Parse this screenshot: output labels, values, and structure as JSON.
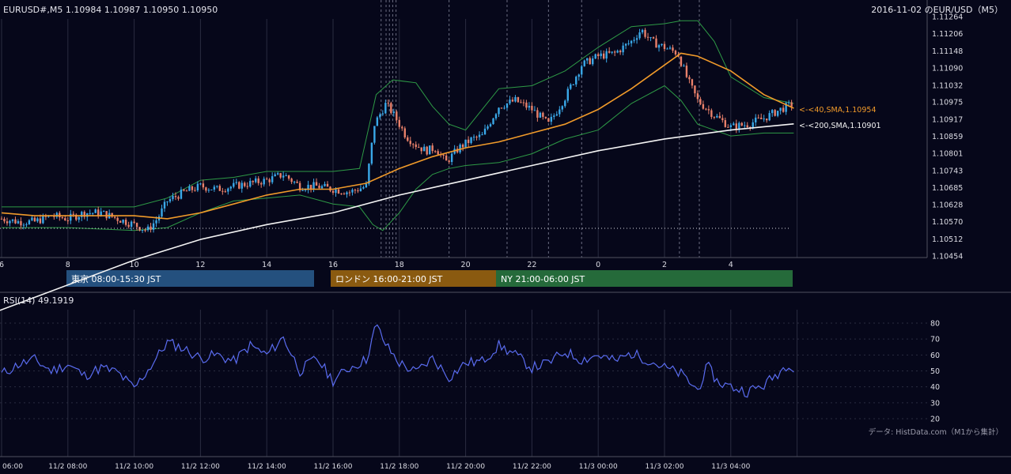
{
  "header": {
    "symbol_info": "EURUSD#,M5 1.10984 1.10987 1.10950 1.10950",
    "title_right": "2016-11-02 のEUR/USD（M5）"
  },
  "colors": {
    "background": "#06071a",
    "candle_up": "#3aa8e8",
    "candle_down": "#e8806a",
    "sma40": "#f09a2a",
    "sma200": "#f4f4f4",
    "bollinger": "#2e9a46",
    "rsi": "#5a6cf0",
    "tokyo": "#24507e",
    "london": "#8a5a10",
    "ny": "#256a3a"
  },
  "sessions": [
    {
      "label": "東京 08:00-15:30 JST",
      "color": "#24507e"
    },
    {
      "label": "ロンドン 16:00-21:00 JST",
      "color": "#8a5a10"
    },
    {
      "label": "NY 21:00-06:00 JST",
      "color": "#256a3a"
    }
  ],
  "ma_labels": {
    "sma40": "<-<40,SMA,1.10954",
    "sma200": "<-<200,SMA,1.10901"
  },
  "rsi_label": "RSI(14) 49.1919",
  "credit": "データ: HistData.com（M1から集計）",
  "chart_data": [
    {
      "type": "candlestick",
      "title": "2016-11-02 のEUR/USD（M5）",
      "ylim": [
        1.10454,
        1.11264
      ],
      "yticks": [
        "1.11264",
        "1.11206",
        "1.11148",
        "1.11090",
        "1.11032",
        "1.10975",
        "1.10917",
        "1.10859",
        "1.10801",
        "1.10743",
        "1.10685",
        "1.10628",
        "1.10570",
        "1.10512",
        "1.10454"
      ],
      "hour_ticks": [
        "6",
        "8",
        "10",
        "12",
        "14",
        "16",
        "18",
        "20",
        "22",
        "0",
        "2",
        "4"
      ],
      "close_path": [
        [
          6.0,
          1.1058
        ],
        [
          6.5,
          1.1057
        ],
        [
          7.0,
          1.1057
        ],
        [
          7.5,
          1.1059
        ],
        [
          8.0,
          1.1058
        ],
        [
          8.5,
          1.106
        ],
        [
          9.0,
          1.106
        ],
        [
          9.5,
          1.1058
        ],
        [
          10.0,
          1.1056
        ],
        [
          10.4,
          1.1054
        ],
        [
          10.7,
          1.1058
        ],
        [
          11.0,
          1.1064
        ],
        [
          11.5,
          1.1067
        ],
        [
          12.0,
          1.1069
        ],
        [
          12.5,
          1.1068
        ],
        [
          13.0,
          1.1069
        ],
        [
          13.5,
          1.107
        ],
        [
          14.0,
          1.1071
        ],
        [
          14.5,
          1.1073
        ],
        [
          15.0,
          1.1069
        ],
        [
          15.5,
          1.1069
        ],
        [
          16.0,
          1.1068
        ],
        [
          16.5,
          1.1067
        ],
        [
          17.0,
          1.1069
        ],
        [
          17.25,
          1.109
        ],
        [
          17.6,
          1.1097
        ],
        [
          17.9,
          1.1092
        ],
        [
          18.2,
          1.1086
        ],
        [
          18.5,
          1.1083
        ],
        [
          18.8,
          1.1081
        ],
        [
          19.1,
          1.1082
        ],
        [
          19.4,
          1.1077
        ],
        [
          19.8,
          1.1082
        ],
        [
          20.2,
          1.1085
        ],
        [
          20.5,
          1.1086
        ],
        [
          20.8,
          1.1092
        ],
        [
          21.0,
          1.1096
        ],
        [
          21.5,
          1.1098
        ],
        [
          22.0,
          1.1095
        ],
        [
          22.5,
          1.109
        ],
        [
          23.0,
          1.1099
        ],
        [
          23.5,
          1.111
        ],
        [
          24.0,
          1.1113
        ],
        [
          24.5,
          1.1114
        ],
        [
          25.0,
          1.1118
        ],
        [
          25.3,
          1.1122
        ],
        [
          25.6,
          1.1118
        ],
        [
          26.0,
          1.1116
        ],
        [
          26.4,
          1.1114
        ],
        [
          26.7,
          1.1105
        ],
        [
          27.0,
          1.1098
        ],
        [
          27.5,
          1.1093
        ],
        [
          28.0,
          1.1089
        ],
        [
          28.5,
          1.109
        ],
        [
          29.0,
          1.1092
        ],
        [
          29.5,
          1.1095
        ],
        [
          29.9,
          1.1097
        ]
      ],
      "sma40_path": [
        [
          6.0,
          1.106
        ],
        [
          7.0,
          1.1059
        ],
        [
          8.0,
          1.1059
        ],
        [
          9.0,
          1.1059
        ],
        [
          10.0,
          1.1059
        ],
        [
          11.0,
          1.1058
        ],
        [
          12.0,
          1.106
        ],
        [
          13.0,
          1.1063
        ],
        [
          14.0,
          1.1066
        ],
        [
          15.0,
          1.1068
        ],
        [
          16.0,
          1.1068
        ],
        [
          17.0,
          1.107
        ],
        [
          18.0,
          1.1075
        ],
        [
          19.0,
          1.1079
        ],
        [
          20.0,
          1.1082
        ],
        [
          21.0,
          1.1084
        ],
        [
          22.0,
          1.1087
        ],
        [
          23.0,
          1.109
        ],
        [
          24.0,
          1.1095
        ],
        [
          25.0,
          1.1102
        ],
        [
          26.0,
          1.111
        ],
        [
          26.5,
          1.1114
        ],
        [
          27.0,
          1.1113
        ],
        [
          28.0,
          1.1108
        ],
        [
          29.0,
          1.11
        ],
        [
          29.9,
          1.10954
        ]
      ],
      "sma200_path": [
        [
          0.0,
          1.0998
        ],
        [
          5.0,
          1.1023
        ],
        [
          10.0,
          1.1044
        ],
        [
          12.0,
          1.1051
        ],
        [
          14.0,
          1.1056
        ],
        [
          16.0,
          1.106
        ],
        [
          18.0,
          1.1066
        ],
        [
          20.0,
          1.1071
        ],
        [
          22.0,
          1.1076
        ],
        [
          24.0,
          1.1081
        ],
        [
          26.0,
          1.1085
        ],
        [
          28.0,
          1.1088
        ],
        [
          29.9,
          1.10901
        ]
      ],
      "bb_upper_path": [
        [
          6.0,
          1.1062
        ],
        [
          8.0,
          1.1062
        ],
        [
          10.0,
          1.1062
        ],
        [
          11.0,
          1.1065
        ],
        [
          12.0,
          1.1071
        ],
        [
          13.0,
          1.1072
        ],
        [
          14.0,
          1.1074
        ],
        [
          15.0,
          1.1074
        ],
        [
          16.0,
          1.1074
        ],
        [
          16.8,
          1.1075
        ],
        [
          17.3,
          1.11
        ],
        [
          17.8,
          1.1105
        ],
        [
          18.5,
          1.1104
        ],
        [
          19.0,
          1.1096
        ],
        [
          19.5,
          1.109
        ],
        [
          20.0,
          1.1088
        ],
        [
          21.0,
          1.1102
        ],
        [
          22.0,
          1.1103
        ],
        [
          23.0,
          1.1108
        ],
        [
          24.0,
          1.1116
        ],
        [
          25.0,
          1.1123
        ],
        [
          26.0,
          1.1124
        ],
        [
          26.5,
          1.1125
        ],
        [
          27.0,
          1.1125
        ],
        [
          27.5,
          1.1118
        ],
        [
          28.0,
          1.1106
        ],
        [
          29.0,
          1.1099
        ],
        [
          29.9,
          1.1097
        ]
      ],
      "bb_lower_path": [
        [
          6.0,
          1.1055
        ],
        [
          8.0,
          1.1055
        ],
        [
          10.0,
          1.1054
        ],
        [
          11.0,
          1.1055
        ],
        [
          12.0,
          1.106
        ],
        [
          13.0,
          1.1064
        ],
        [
          14.0,
          1.1065
        ],
        [
          15.0,
          1.1066
        ],
        [
          16.0,
          1.1063
        ],
        [
          16.8,
          1.1062
        ],
        [
          17.2,
          1.1056
        ],
        [
          17.5,
          1.1054
        ],
        [
          18.0,
          1.106
        ],
        [
          18.5,
          1.1068
        ],
        [
          19.0,
          1.1073
        ],
        [
          19.5,
          1.1075
        ],
        [
          20.0,
          1.1076
        ],
        [
          21.0,
          1.1077
        ],
        [
          22.0,
          1.108
        ],
        [
          23.0,
          1.1085
        ],
        [
          24.0,
          1.1088
        ],
        [
          25.0,
          1.1097
        ],
        [
          26.0,
          1.1103
        ],
        [
          26.5,
          1.1098
        ],
        [
          27.0,
          1.109
        ],
        [
          28.0,
          1.1086
        ],
        [
          29.0,
          1.1087
        ],
        [
          29.9,
          1.1087
        ]
      ]
    },
    {
      "type": "line",
      "title": "RSI(14) 49.1919",
      "ylim": [
        20,
        80
      ],
      "yticks": [
        80,
        70,
        60,
        50,
        40,
        30,
        20
      ],
      "time_ticks": [
        "06:00",
        "11/2 08:00",
        "11/2 10:00",
        "11/2 12:00",
        "11/2 14:00",
        "11/2 16:00",
        "11/2 18:00",
        "11/2 20:00",
        "11/2 22:00",
        "11/3 00:00",
        "11/3 02:00",
        "11/3 04:00"
      ],
      "rsi_path": [
        [
          6.0,
          48
        ],
        [
          6.5,
          54
        ],
        [
          7.0,
          57
        ],
        [
          7.5,
          50
        ],
        [
          8.0,
          54
        ],
        [
          8.5,
          47
        ],
        [
          9.0,
          52
        ],
        [
          9.5,
          49
        ],
        [
          10.0,
          39
        ],
        [
          10.5,
          53
        ],
        [
          11.0,
          68
        ],
        [
          11.5,
          64
        ],
        [
          12.0,
          58
        ],
        [
          12.5,
          60
        ],
        [
          13.0,
          56
        ],
        [
          13.5,
          66
        ],
        [
          14.0,
          60
        ],
        [
          14.5,
          71
        ],
        [
          15.0,
          50
        ],
        [
          15.5,
          58
        ],
        [
          16.0,
          44
        ],
        [
          16.5,
          52
        ],
        [
          17.0,
          57
        ],
        [
          17.3,
          79
        ],
        [
          17.6,
          66
        ],
        [
          18.0,
          55
        ],
        [
          18.5,
          49
        ],
        [
          19.0,
          58
        ],
        [
          19.5,
          46
        ],
        [
          20.0,
          55
        ],
        [
          20.5,
          56
        ],
        [
          21.0,
          66
        ],
        [
          21.5,
          60
        ],
        [
          22.0,
          52
        ],
        [
          22.5,
          55
        ],
        [
          23.0,
          62
        ],
        [
          23.5,
          57
        ],
        [
          24.0,
          60
        ],
        [
          24.5,
          56
        ],
        [
          25.0,
          61
        ],
        [
          25.5,
          57
        ],
        [
          26.0,
          52
        ],
        [
          26.5,
          48
        ],
        [
          27.0,
          38
        ],
        [
          27.3,
          53
        ],
        [
          27.6,
          43
        ],
        [
          28.0,
          40
        ],
        [
          28.5,
          37
        ],
        [
          29.0,
          41
        ],
        [
          29.5,
          50
        ],
        [
          29.8,
          56
        ],
        [
          29.9,
          49.19
        ]
      ]
    }
  ]
}
